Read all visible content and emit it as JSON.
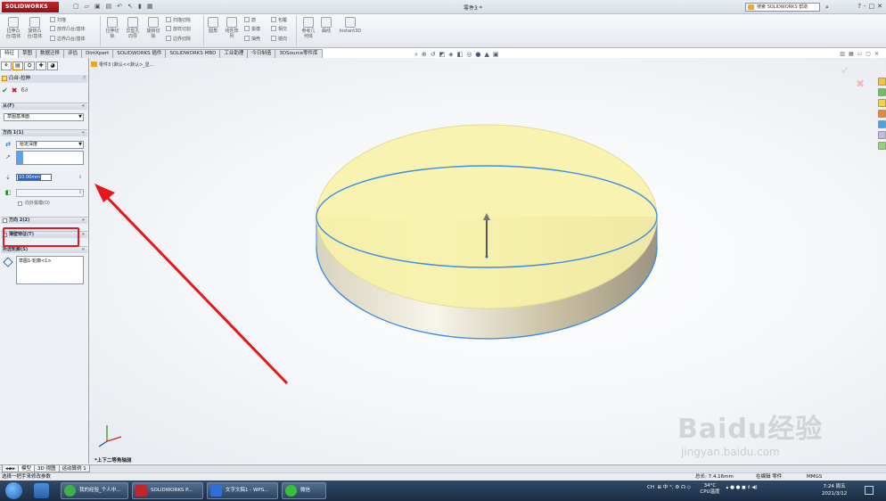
{
  "app": {
    "logo_text": "SOLIDWORKS",
    "doc_title": "零件3 *",
    "search_placeholder": "搜索 SOLIDWORKS 帮助",
    "help_label": "?",
    "win_min": "-",
    "win_max": "□",
    "win_close": "✕"
  },
  "ribbon": {
    "extrude_boss": "拉伸凸\n台/基体",
    "revolve_boss": "旋转凸\n台/基体",
    "sweep": "扫描",
    "loft": "放样凸台/基体",
    "boundary": "边界凸台/基体",
    "extrude_cut": "拉伸切\n除",
    "hole_wizard": "异型孔\n向导",
    "revolve_cut": "旋转切\n除",
    "swept_cut": "扫描切除",
    "lofted_cut": "放样切割",
    "boundary_cut": "边界切除",
    "fillet": "圆角",
    "linear_pattern": "线性阵\n列",
    "rib": "筋",
    "draft": "拔模",
    "shell": "抽壳",
    "wrap": "包覆",
    "intersect": "相交",
    "mirror": "镜向",
    "ref_geom": "参考几\n何体",
    "curves": "曲线",
    "instant3d": "Instant3D"
  },
  "cmd_tabs": [
    "特征",
    "草图",
    "数据迁移",
    "评估",
    "DimXpert",
    "SOLIDWORKS 插件",
    "SOLIDWORKS MBD",
    "工业助理",
    "今日制造",
    "3DSource零件库"
  ],
  "panel": {
    "title": "凸台-拉伸",
    "help": "?",
    "ok": "✔",
    "cancel": "✖",
    "preview": "6∂",
    "from_header": "从(F)",
    "from_value": "草图基准面",
    "dir1_header": "方向 1(1)",
    "end_condition": "给定深度",
    "depth_value": "10.00mm",
    "merge_label": "向外拔模(O)",
    "dir2_header": "方向 2(2)",
    "thin_header": "薄壁特征(T)",
    "contours_header": "所选轮廓(S)",
    "contour_item": "草图1-轮廓<1>",
    "chev_up": "«",
    "chev_down": "»"
  },
  "viewport": {
    "part_label": "零件3 (默认<<默认>_显...",
    "view_name": "*上下二等角轴测"
  },
  "bottom_tabs": [
    "模型",
    "3D 视图",
    "运动算例 1"
  ],
  "status": {
    "message": "选择一把手来修改参数",
    "coords": "总长: 7.4.16mm",
    "mode": "在编辑 零件",
    "units": "MMGS"
  },
  "taskbar": {
    "apps": [
      "我的经验_个人中...",
      "SOLIDWORKS P...",
      "文字文稿1 - WPS...",
      "微信"
    ],
    "ime": "CH",
    "temp": "34°C",
    "cpu": "CPU温度",
    "time": "7:24 周五",
    "date": "2021/3/12"
  },
  "watermark": {
    "text": "Baidu经验",
    "url": "jingyan.baidu.com"
  },
  "colors": {
    "accent_red": "#e8161c",
    "part_fill": "#f7f2a8",
    "edge_blue": "#3d8de6"
  }
}
